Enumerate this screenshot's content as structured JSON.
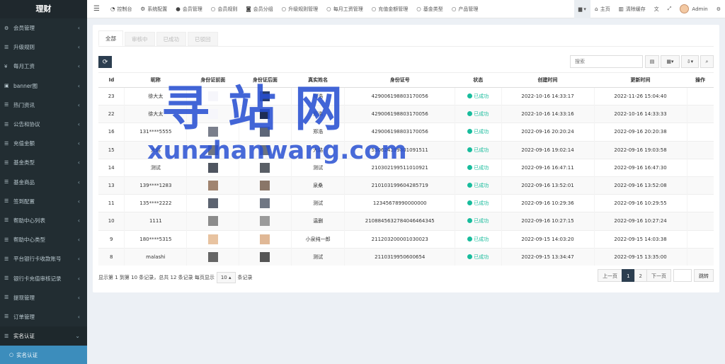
{
  "app": {
    "title": "理财"
  },
  "sidebar": {
    "items": [
      {
        "label": "会员管理",
        "icon": "gear-icon"
      },
      {
        "label": "升级规则",
        "icon": "list-icon"
      },
      {
        "label": "每月工资",
        "icon": "yen-icon"
      },
      {
        "label": "banner图",
        "icon": "image-icon"
      },
      {
        "label": "热门资讯",
        "icon": "list-icon"
      },
      {
        "label": "公告和协议",
        "icon": "list-icon"
      },
      {
        "label": "充值金额",
        "icon": "list-icon"
      },
      {
        "label": "基金类型",
        "icon": "list-icon"
      },
      {
        "label": "基金商品",
        "icon": "list-icon"
      },
      {
        "label": "签到配置",
        "icon": "list-icon"
      },
      {
        "label": "帮助中心列表",
        "icon": "list-icon"
      },
      {
        "label": "帮助中心类型",
        "icon": "list-icon"
      },
      {
        "label": "平台银行卡收款账号",
        "icon": "list-icon"
      },
      {
        "label": "银行卡充值审核记录",
        "icon": "list-icon"
      },
      {
        "label": "提现管理",
        "icon": "list-icon"
      },
      {
        "label": "订单管理",
        "icon": "list-icon"
      },
      {
        "label": "实名认证",
        "icon": "list-icon"
      }
    ],
    "sub_item": "实名认证"
  },
  "topbar": {
    "items": [
      {
        "label": "控制台",
        "icon": "dashboard-icon"
      },
      {
        "label": "系统配置",
        "icon": "gear-icon"
      },
      {
        "label": "会员管理",
        "icon": "user-icon"
      },
      {
        "label": "会员规则",
        "icon": "circle-icon"
      },
      {
        "label": "会员分组",
        "icon": "users-icon"
      },
      {
        "label": "升级规则管理",
        "icon": "circle-icon"
      },
      {
        "label": "每月工资管理",
        "icon": "circle-icon"
      },
      {
        "label": "充值金额管理",
        "icon": "circle-icon"
      },
      {
        "label": "基金类型",
        "icon": "circle-icon"
      },
      {
        "label": "产品管理",
        "icon": "circle-icon"
      }
    ],
    "home": "主页",
    "clear_cache": "清除缓存",
    "user": "Admin"
  },
  "tabs": [
    "全部",
    "审核中",
    "已成功",
    "已驳回"
  ],
  "search": {
    "placeholder": "搜索"
  },
  "table": {
    "headers": [
      "Id",
      "昵称",
      "身份证前面",
      "身份证后面",
      "真实姓名",
      "身份证号",
      "状态",
      "创建时间",
      "更新时间",
      "操作"
    ],
    "rows": [
      {
        "id": "23",
        "nickname": "徐大太",
        "name": "郑浩",
        "idno": "429006198803170056",
        "status": "已成功",
        "created": "2022-10-16 14:33:17",
        "updated": "2022-11-26 15:04:40",
        "front": "#f6f6fb",
        "back": "#283d6e"
      },
      {
        "id": "22",
        "nickname": "徐大太",
        "name": "郑浩",
        "idno": "429006198803170056",
        "status": "已成功",
        "created": "2022-10-16 14:33:16",
        "updated": "2022-10-16 14:33:33",
        "front": "#f6f6fb",
        "back": "#1e2d55"
      },
      {
        "id": "16",
        "nickname": "131****5555",
        "name": "郑浩",
        "idno": "429006198803170056",
        "status": "已成功",
        "created": "2022-09-16 20:20:24",
        "updated": "2022-09-16 20:20:38",
        "front": "#7a7f8c",
        "back": "#5d6678"
      },
      {
        "id": "15",
        "nickname": "大路",
        "name": "大路",
        "idno": "530624199801091511",
        "status": "已成功",
        "created": "2022-09-16 19:02:14",
        "updated": "2022-09-16 19:03:58",
        "front": "#6f7583",
        "back": "#6a7280"
      },
      {
        "id": "14",
        "nickname": "测试",
        "name": "测试",
        "idno": "210302199511010921",
        "status": "已成功",
        "created": "2022-09-16 16:47:11",
        "updated": "2022-09-16 16:47:30",
        "front": "#4f5560",
        "back": "#5a5f66"
      },
      {
        "id": "13",
        "nickname": "139****1283",
        "name": "泉桑",
        "idno": "210103199604285719",
        "status": "已成功",
        "created": "2022-09-16 13:52:01",
        "updated": "2022-09-16 13:52:08",
        "front": "#a08470",
        "back": "#8a7668"
      },
      {
        "id": "11",
        "nickname": "135****2222",
        "name": "测试",
        "idno": "12345678990000000",
        "status": "已成功",
        "created": "2022-09-16 10:29:36",
        "updated": "2022-09-16 10:29:55",
        "front": "#5c6370",
        "back": "#707784"
      },
      {
        "id": "10",
        "nickname": "1111",
        "name": "温删",
        "idno": "210884563278404646434​5",
        "status": "已成功",
        "created": "2022-09-16 10:27:15",
        "updated": "2022-09-16 10:27:24",
        "front": "#8c8c8c",
        "back": "#9b9b9b"
      },
      {
        "id": "9",
        "nickname": "180****5315",
        "name": "小泉纯一郎",
        "idno": "211203200001030023",
        "status": "已成功",
        "created": "2022-09-15 14:03:20",
        "updated": "2022-09-15 14:03:38",
        "front": "#e8c3a0",
        "back": "#e0b896"
      },
      {
        "id": "8",
        "nickname": "malashi",
        "name": "测试",
        "idno": "211031995060​0654",
        "status": "已成功",
        "created": "2022-09-15 13:34:47",
        "updated": "2022-09-15 13:35:00",
        "front": "#666666",
        "back": "#555555"
      }
    ]
  },
  "pagination": {
    "info_prefix": "显示第 1 到第 10 条记录，总共 12 条记录 每页显示",
    "page_size": "10",
    "info_suffix": "条记录",
    "prev": "上一页",
    "pages": [
      "1",
      "2"
    ],
    "next": "下一页",
    "jump": "跳转"
  },
  "watermark": {
    "line1": "寻站网",
    "line2": "xunzhanwang.com"
  }
}
